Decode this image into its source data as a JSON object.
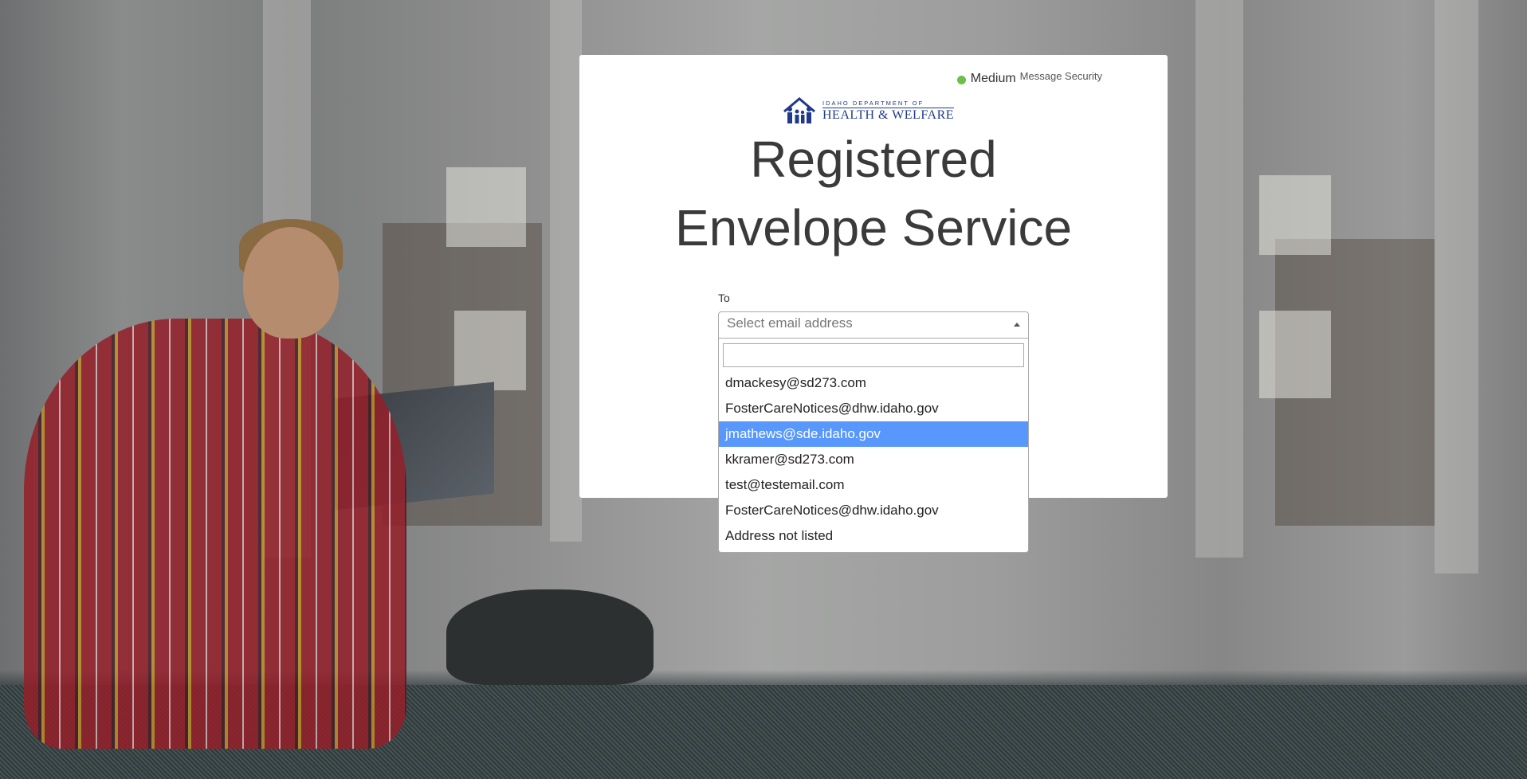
{
  "security": {
    "level": "Medium",
    "label": "Message Security",
    "status_color": "#6dbf4b"
  },
  "logo": {
    "top_text": "IDAHO DEPARTMENT OF",
    "bottom_text": "HEALTH & WELFARE",
    "icon": "family-silhouette-icon"
  },
  "title": {
    "line1": "Registered",
    "line2": "Envelope Service"
  },
  "form": {
    "to_label": "To",
    "select_placeholder": "Select email address",
    "search_value": ""
  },
  "dropdown": {
    "options": [
      "dmackesy@sd273.com",
      "FosterCareNotices@dhw.idaho.gov",
      "jmathews@sde.idaho.gov",
      "kkramer@sd273.com",
      "test@testemail.com",
      "FosterCareNotices@dhw.idaho.gov",
      "Address not listed"
    ],
    "highlighted": "jmathews@sde.idaho.gov"
  },
  "colors": {
    "highlight": "#5897fb",
    "brand": "#1f3a8a"
  }
}
